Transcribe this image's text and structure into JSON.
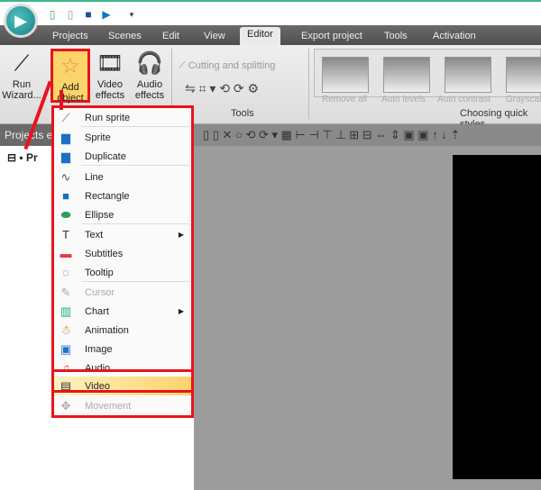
{
  "quick_access": {
    "icons": [
      "new-project-icon",
      "copy-icon",
      "save-icon",
      "play-icon",
      "customize-icon"
    ]
  },
  "tabs": [
    "Projects",
    "Scenes",
    "Edit",
    "View",
    "Editor",
    "Export project",
    "Tools",
    "Activation"
  ],
  "active_tab": "Editor",
  "ribbon": {
    "run_wizard": "Run Wizard...",
    "add_object": "Add object",
    "video_effects": "Video effects",
    "audio_effects": "Audio effects",
    "cutting": "Cutting and splitting",
    "tools_group": "Tools",
    "styles": [
      "Remove all",
      "Auto levels",
      "Auto contrast",
      "Grayscale"
    ],
    "styles_group": "Choosing quick styles"
  },
  "panel": {
    "title": "Projects e",
    "tree_root": "Pr"
  },
  "menu": {
    "items": [
      {
        "label": "Run sprite",
        "icon": "wand-icon"
      },
      {
        "label": "Sprite",
        "icon": "sprite-icon"
      },
      {
        "label": "Duplicate",
        "icon": "duplicate-icon"
      },
      {
        "label": "Line",
        "icon": "line-icon"
      },
      {
        "label": "Rectangle",
        "icon": "rectangle-icon"
      },
      {
        "label": "Ellipse",
        "icon": "ellipse-icon"
      },
      {
        "label": "Text",
        "icon": "text-icon",
        "submenu": true
      },
      {
        "label": "Subtitles",
        "icon": "subtitles-icon"
      },
      {
        "label": "Tooltip",
        "icon": "tooltip-icon"
      },
      {
        "label": "Cursor",
        "icon": "cursor-icon",
        "disabled": true
      },
      {
        "label": "Chart",
        "icon": "chart-icon",
        "submenu": true
      },
      {
        "label": "Animation",
        "icon": "animation-icon"
      },
      {
        "label": "Image",
        "icon": "image-icon"
      },
      {
        "label": "Audio",
        "icon": "audio-icon"
      },
      {
        "label": "Video",
        "icon": "video-icon",
        "highlighted": true
      },
      {
        "label": "Movement",
        "icon": "move-icon",
        "disabled": true
      }
    ]
  }
}
